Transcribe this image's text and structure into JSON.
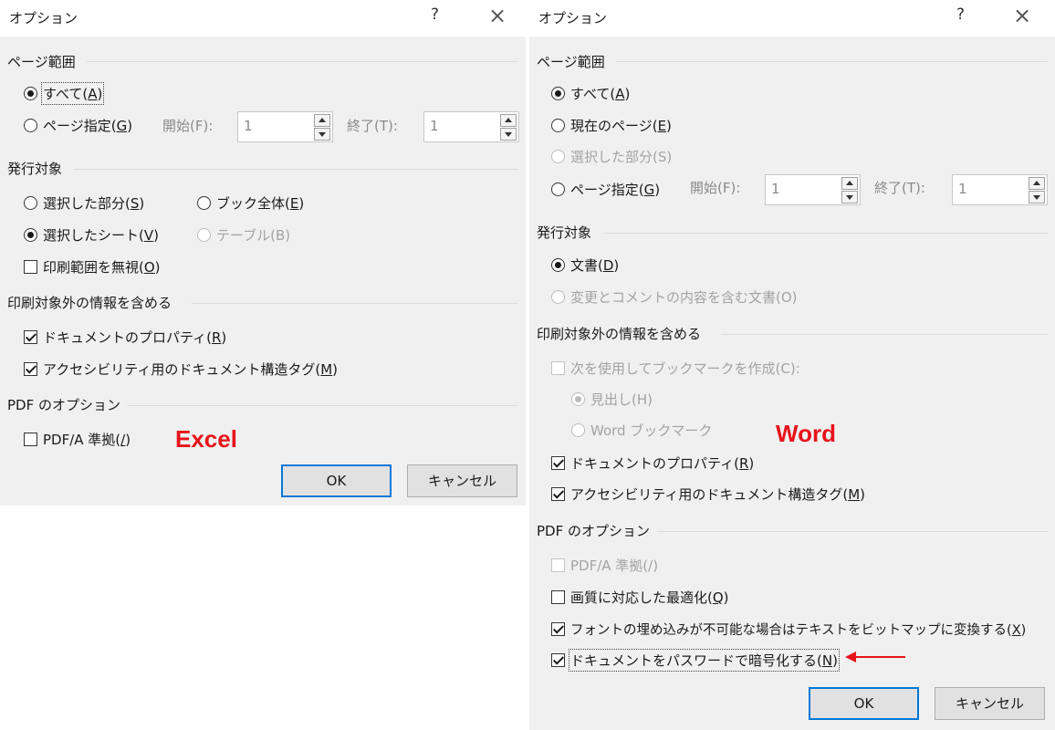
{
  "excel": {
    "title": "オプション",
    "help": "?",
    "close": "×",
    "page_range": {
      "heading": "ページ範囲",
      "all": {
        "label": "すべて(",
        "key": "A",
        "end": ")"
      },
      "pages": {
        "label": "ページ指定(",
        "key": "G",
        "end": ")"
      },
      "from_label": "開始(F):",
      "from_value": "1",
      "to_label": "終了(T):",
      "to_value": "1"
    },
    "publish": {
      "heading": "発行対象",
      "selection": {
        "label": "選択した部分(",
        "key": "S",
        "end": ")"
      },
      "workbook": {
        "label": "ブック全体(",
        "key": "E",
        "end": ")"
      },
      "sheets": {
        "label": "選択したシート(",
        "key": "V",
        "end": ")"
      },
      "table": {
        "label": "テーブル(B)"
      },
      "ignore_print_area": {
        "label": "印刷範囲を無視(",
        "key": "O",
        "end": ")"
      }
    },
    "nonprint": {
      "heading": "印刷対象外の情報を含める",
      "doc_props": {
        "label": "ドキュメントのプロパティ(",
        "key": "R",
        "end": ")"
      },
      "struct_tags": {
        "label": "アクセシビリティ用のドキュメント構造タグ(",
        "key": "M",
        "end": ")"
      }
    },
    "pdf": {
      "heading": "PDF のオプション",
      "pdfa": {
        "label": "PDF/A 準拠(",
        "key": "/",
        "end": ")"
      }
    },
    "badge": "Excel",
    "ok": "OK",
    "cancel": "キャンセル"
  },
  "word": {
    "title": "オプション",
    "help": "?",
    "close": "×",
    "page_range": {
      "heading": "ページ範囲",
      "all": {
        "label": "すべて(",
        "key": "A",
        "end": ")"
      },
      "current": {
        "label": "現在のページ(",
        "key": "E",
        "end": ")"
      },
      "selection": {
        "label": "選択した部分(S)"
      },
      "pages": {
        "label": "ページ指定(",
        "key": "G",
        "end": ")"
      },
      "from_label": "開始(F):",
      "from_value": "1",
      "to_label": "終了(T):",
      "to_value": "1"
    },
    "publish": {
      "heading": "発行対象",
      "document": {
        "label": "文書(",
        "key": "D",
        "end": ")"
      },
      "with_markup": {
        "label": "変更とコメントの内容を含む文書(O)"
      }
    },
    "nonprint": {
      "heading": "印刷対象外の情報を含める",
      "bookmarks": {
        "label": "次を使用してブックマークを作成(C):"
      },
      "headings": {
        "label": "見出し(H)"
      },
      "word_bookmarks": {
        "label": "Word ブックマーク"
      },
      "doc_props": {
        "label": "ドキュメントのプロパティ(",
        "key": "R",
        "end": ")"
      },
      "struct_tags": {
        "label": "アクセシビリティ用のドキュメント構造タグ(",
        "key": "M",
        "end": ")"
      }
    },
    "pdf": {
      "heading": "PDF のオプション",
      "pdfa": {
        "label": "PDF/A 準拠(/)"
      },
      "optimize": {
        "label": "画質に対応した最適化(",
        "key": "Q",
        "end": ")"
      },
      "bitmap": {
        "label": "フォントの埋め込みが不可能な場合はテキストをビットマップに変換する(",
        "key": "X",
        "end": ")"
      },
      "encrypt": {
        "label": "ドキュメントをパスワードで暗号化する(",
        "key": "N",
        "end": ")"
      }
    },
    "badge": "Word",
    "ok": "OK",
    "cancel": "キャンセル"
  },
  "colors": {
    "dialog_bg": "#f0f0f0",
    "title_bg": "#ffffff",
    "badge": "#e8141a",
    "arrow": "#e8141a",
    "ok_border": "#0078d7",
    "disabled_text": "#a3a3a3"
  }
}
